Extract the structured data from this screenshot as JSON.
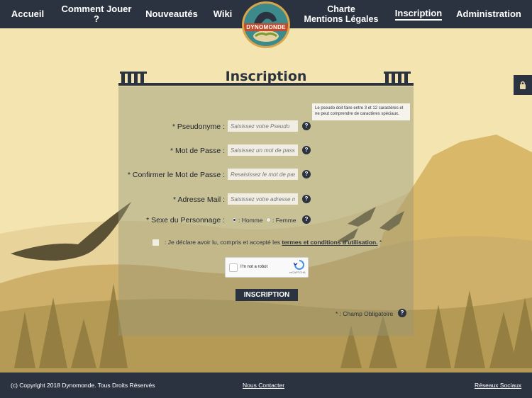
{
  "nav": {
    "items": [
      {
        "label": "Accueil"
      },
      {
        "label": "Comment Jouer ?"
      },
      {
        "label": "Nouveautés"
      },
      {
        "label": "Wiki"
      },
      {
        "label_line1": "Charte",
        "label_line2": "Mentions Légales"
      },
      {
        "label": "Inscription"
      },
      {
        "label": "Administration"
      }
    ],
    "logo_text": "DYNOMONDE"
  },
  "form": {
    "title": "Inscription",
    "tooltip": "Le pseudo doit faire entre 3 et 12 caractères et ne peut comprendre de caractères spéciaux.",
    "pseudo": {
      "label": "* Pseudonyme :",
      "placeholder": "Saisissez votre Pseudo"
    },
    "password": {
      "label": "* Mot de Passe :",
      "placeholder": "Saisissez un mot de passe"
    },
    "confirm": {
      "label": "* Confirmer le Mot de Passe :",
      "placeholder": "Resaisissez le mot de passe"
    },
    "email": {
      "label": "* Adresse Mail :",
      "placeholder": "Saisissez votre adresse mail"
    },
    "sexe": {
      "label": "* Sexe du Personnage :",
      "option_homme": ": Homme",
      "option_femme": ": Femme",
      "selected": "homme"
    },
    "accept": {
      "prefix": ": Je déclare avoir lu, compris et accepté les ",
      "link": "termes et conditions d'utilisation.",
      "suffix": " *"
    },
    "captcha": {
      "label": "I'm not a robot",
      "brand": "reCAPTCHA"
    },
    "submit_label": "INSCRIPTION",
    "required_note": "* : Champ Obligatoire",
    "help_glyph": "?"
  },
  "footer": {
    "copyright": "(c) Copyright 2018 Dynomonde. Tous Droits Réservés",
    "contact": "Nous Contacter",
    "social": "Réseaux Sociaux"
  },
  "colors": {
    "nav_bg": "#2c3340",
    "sky": "#f3e4b0",
    "accent": "#d8a54a"
  }
}
